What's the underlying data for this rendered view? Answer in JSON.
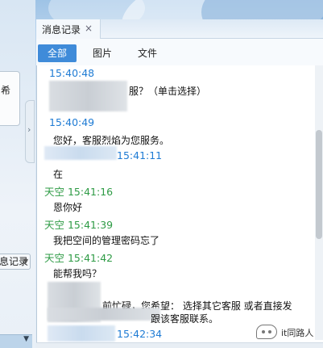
{
  "left_pane": {
    "card_char": "希",
    "history_button": "息记录"
  },
  "tabs": [
    {
      "label": "消息记录",
      "close": "×"
    }
  ],
  "filters": [
    {
      "label": "全部",
      "active": true
    },
    {
      "label": "图片",
      "active": false
    },
    {
      "label": "文件",
      "active": false
    }
  ],
  "messages": {
    "m1_time": "15:40:48",
    "m1_text": "服？（单击选择）",
    "m2_time": "15:40:49",
    "m2_text": "您好，客服烈焰为您服务。",
    "m3_time": "15:41:11",
    "m3_text": "在",
    "m4_sender_time": "天空 15:41:16",
    "m4_text": "恩你好",
    "m5_sender_time": "天空 15:41:39",
    "m5_text": "我把空间的管理密码忘了",
    "m6_sender_time": "天空 15:41:42",
    "m6_text": "能帮我吗？",
    "m7_text_line1": "前忙碌，您希望：  选择其它客服  或者直接发",
    "m7_text_line2": "跟该客服联系。",
    "m8_time": "15:42:34"
  },
  "watermark": {
    "text": "it同路人"
  },
  "colors": {
    "time_blue": "#1e7bd4",
    "sender_green": "#2e9b45",
    "active_tab": "#3f8bd9"
  }
}
